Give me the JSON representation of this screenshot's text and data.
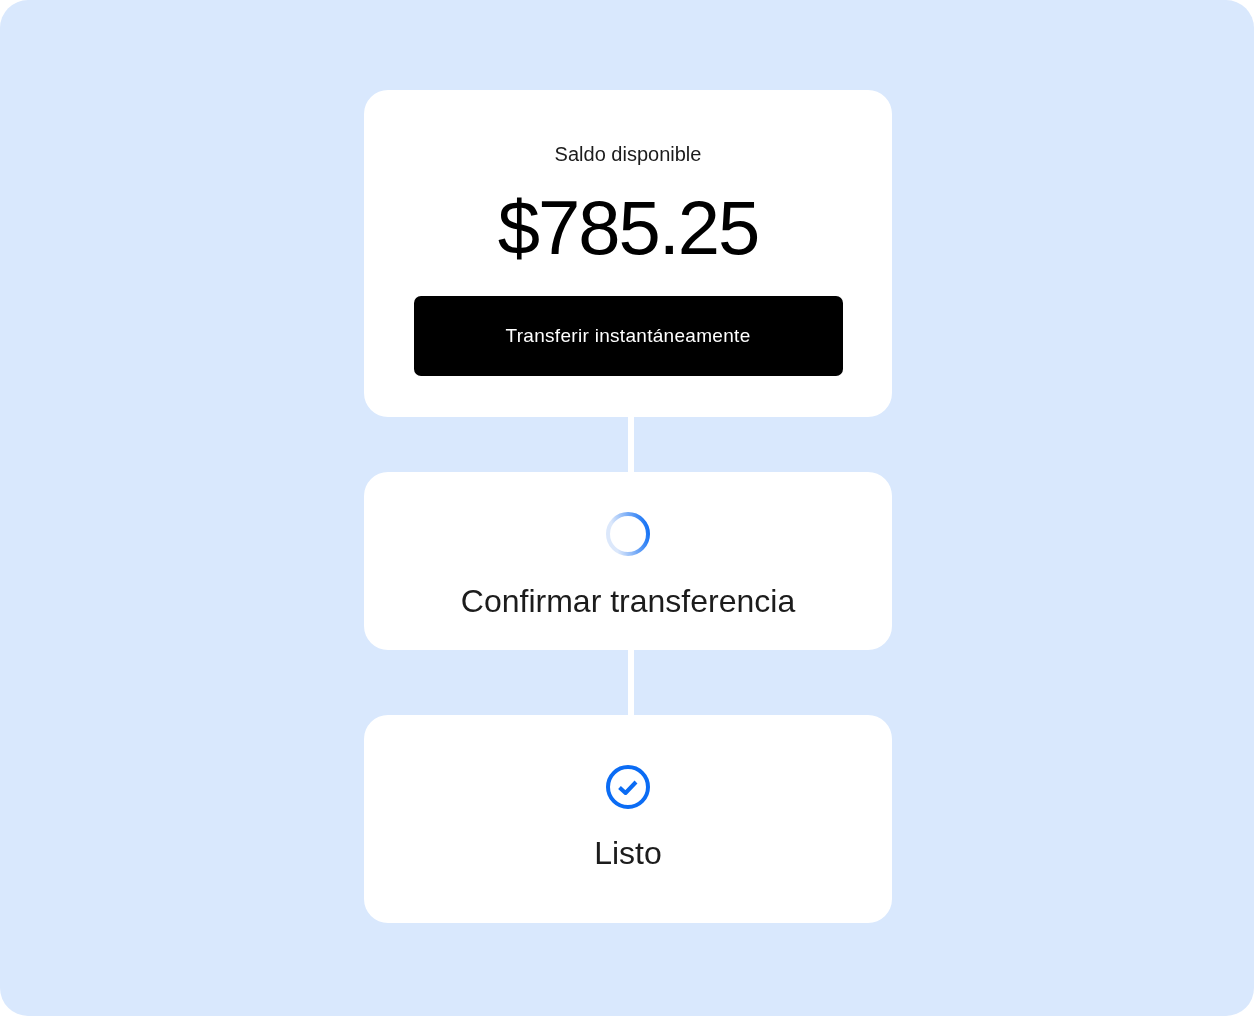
{
  "balance_card": {
    "label": "Saldo disponible",
    "amount": "$785.25",
    "button": "Transferir instantáneamente"
  },
  "steps": [
    {
      "kind": "pending",
      "label": "Confirmar transferencia"
    },
    {
      "kind": "done",
      "label": "Listo"
    }
  ]
}
